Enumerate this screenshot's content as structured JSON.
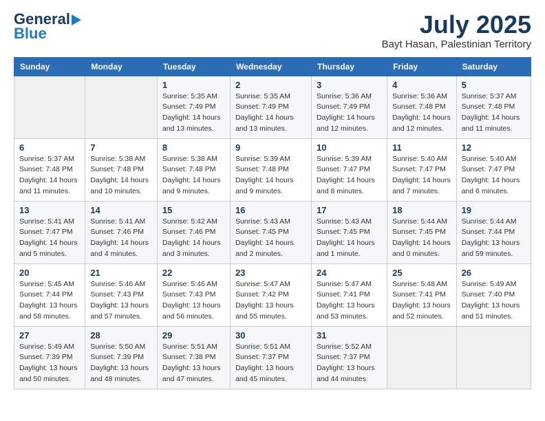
{
  "header": {
    "logo_line1": "General",
    "logo_line2": "Blue",
    "month": "July 2025",
    "location": "Bayt Hasan, Palestinian Territory"
  },
  "days_of_week": [
    "Sunday",
    "Monday",
    "Tuesday",
    "Wednesday",
    "Thursday",
    "Friday",
    "Saturday"
  ],
  "weeks": [
    [
      {
        "day": "",
        "sunrise": "",
        "sunset": "",
        "daylight": ""
      },
      {
        "day": "",
        "sunrise": "",
        "sunset": "",
        "daylight": ""
      },
      {
        "day": "1",
        "sunrise": "Sunrise: 5:35 AM",
        "sunset": "Sunset: 7:49 PM",
        "daylight": "Daylight: 14 hours and 13 minutes."
      },
      {
        "day": "2",
        "sunrise": "Sunrise: 5:35 AM",
        "sunset": "Sunset: 7:49 PM",
        "daylight": "Daylight: 14 hours and 13 minutes."
      },
      {
        "day": "3",
        "sunrise": "Sunrise: 5:36 AM",
        "sunset": "Sunset: 7:49 PM",
        "daylight": "Daylight: 14 hours and 12 minutes."
      },
      {
        "day": "4",
        "sunrise": "Sunrise: 5:36 AM",
        "sunset": "Sunset: 7:48 PM",
        "daylight": "Daylight: 14 hours and 12 minutes."
      },
      {
        "day": "5",
        "sunrise": "Sunrise: 5:37 AM",
        "sunset": "Sunset: 7:48 PM",
        "daylight": "Daylight: 14 hours and 11 minutes."
      }
    ],
    [
      {
        "day": "6",
        "sunrise": "Sunrise: 5:37 AM",
        "sunset": "Sunset: 7:48 PM",
        "daylight": "Daylight: 14 hours and 11 minutes."
      },
      {
        "day": "7",
        "sunrise": "Sunrise: 5:38 AM",
        "sunset": "Sunset: 7:48 PM",
        "daylight": "Daylight: 14 hours and 10 minutes."
      },
      {
        "day": "8",
        "sunrise": "Sunrise: 5:38 AM",
        "sunset": "Sunset: 7:48 PM",
        "daylight": "Daylight: 14 hours and 9 minutes."
      },
      {
        "day": "9",
        "sunrise": "Sunrise: 5:39 AM",
        "sunset": "Sunset: 7:48 PM",
        "daylight": "Daylight: 14 hours and 9 minutes."
      },
      {
        "day": "10",
        "sunrise": "Sunrise: 5:39 AM",
        "sunset": "Sunset: 7:47 PM",
        "daylight": "Daylight: 14 hours and 8 minutes."
      },
      {
        "day": "11",
        "sunrise": "Sunrise: 5:40 AM",
        "sunset": "Sunset: 7:47 PM",
        "daylight": "Daylight: 14 hours and 7 minutes."
      },
      {
        "day": "12",
        "sunrise": "Sunrise: 5:40 AM",
        "sunset": "Sunset: 7:47 PM",
        "daylight": "Daylight: 14 hours and 6 minutes."
      }
    ],
    [
      {
        "day": "13",
        "sunrise": "Sunrise: 5:41 AM",
        "sunset": "Sunset: 7:47 PM",
        "daylight": "Daylight: 14 hours and 5 minutes."
      },
      {
        "day": "14",
        "sunrise": "Sunrise: 5:41 AM",
        "sunset": "Sunset: 7:46 PM",
        "daylight": "Daylight: 14 hours and 4 minutes."
      },
      {
        "day": "15",
        "sunrise": "Sunrise: 5:42 AM",
        "sunset": "Sunset: 7:46 PM",
        "daylight": "Daylight: 14 hours and 3 minutes."
      },
      {
        "day": "16",
        "sunrise": "Sunrise: 5:43 AM",
        "sunset": "Sunset: 7:45 PM",
        "daylight": "Daylight: 14 hours and 2 minutes."
      },
      {
        "day": "17",
        "sunrise": "Sunrise: 5:43 AM",
        "sunset": "Sunset: 7:45 PM",
        "daylight": "Daylight: 14 hours and 1 minute."
      },
      {
        "day": "18",
        "sunrise": "Sunrise: 5:44 AM",
        "sunset": "Sunset: 7:45 PM",
        "daylight": "Daylight: 14 hours and 0 minutes."
      },
      {
        "day": "19",
        "sunrise": "Sunrise: 5:44 AM",
        "sunset": "Sunset: 7:44 PM",
        "daylight": "Daylight: 13 hours and 59 minutes."
      }
    ],
    [
      {
        "day": "20",
        "sunrise": "Sunrise: 5:45 AM",
        "sunset": "Sunset: 7:44 PM",
        "daylight": "Daylight: 13 hours and 58 minutes."
      },
      {
        "day": "21",
        "sunrise": "Sunrise: 5:46 AM",
        "sunset": "Sunset: 7:43 PM",
        "daylight": "Daylight: 13 hours and 57 minutes."
      },
      {
        "day": "22",
        "sunrise": "Sunrise: 5:46 AM",
        "sunset": "Sunset: 7:43 PM",
        "daylight": "Daylight: 13 hours and 56 minutes."
      },
      {
        "day": "23",
        "sunrise": "Sunrise: 5:47 AM",
        "sunset": "Sunset: 7:42 PM",
        "daylight": "Daylight: 13 hours and 55 minutes."
      },
      {
        "day": "24",
        "sunrise": "Sunrise: 5:47 AM",
        "sunset": "Sunset: 7:41 PM",
        "daylight": "Daylight: 13 hours and 53 minutes."
      },
      {
        "day": "25",
        "sunrise": "Sunrise: 5:48 AM",
        "sunset": "Sunset: 7:41 PM",
        "daylight": "Daylight: 13 hours and 52 minutes."
      },
      {
        "day": "26",
        "sunrise": "Sunrise: 5:49 AM",
        "sunset": "Sunset: 7:40 PM",
        "daylight": "Daylight: 13 hours and 51 minutes."
      }
    ],
    [
      {
        "day": "27",
        "sunrise": "Sunrise: 5:49 AM",
        "sunset": "Sunset: 7:39 PM",
        "daylight": "Daylight: 13 hours and 50 minutes."
      },
      {
        "day": "28",
        "sunrise": "Sunrise: 5:50 AM",
        "sunset": "Sunset: 7:39 PM",
        "daylight": "Daylight: 13 hours and 48 minutes."
      },
      {
        "day": "29",
        "sunrise": "Sunrise: 5:51 AM",
        "sunset": "Sunset: 7:38 PM",
        "daylight": "Daylight: 13 hours and 47 minutes."
      },
      {
        "day": "30",
        "sunrise": "Sunrise: 5:51 AM",
        "sunset": "Sunset: 7:37 PM",
        "daylight": "Daylight: 13 hours and 45 minutes."
      },
      {
        "day": "31",
        "sunrise": "Sunrise: 5:52 AM",
        "sunset": "Sunset: 7:37 PM",
        "daylight": "Daylight: 13 hours and 44 minutes."
      },
      {
        "day": "",
        "sunrise": "",
        "sunset": "",
        "daylight": ""
      },
      {
        "day": "",
        "sunrise": "",
        "sunset": "",
        "daylight": ""
      }
    ]
  ]
}
